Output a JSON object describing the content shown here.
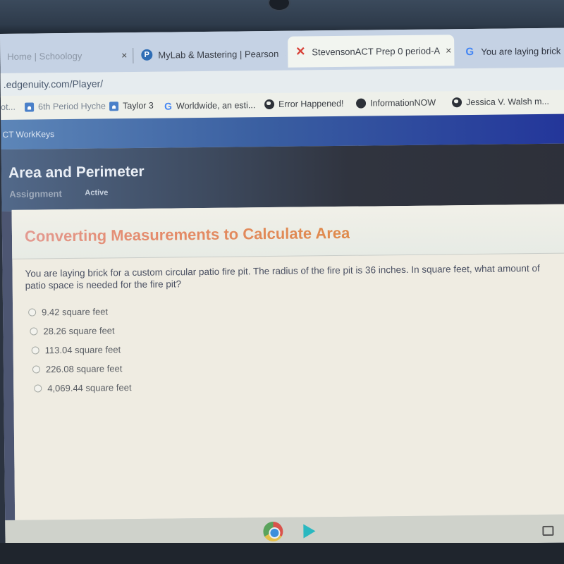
{
  "browser": {
    "tabs": [
      {
        "label": "Home | Schoology",
        "icon": "schoology-icon",
        "active": false,
        "faded": true
      },
      {
        "label": "MyLab & Mastering | Pearson",
        "icon": "pearson-icon",
        "active": false
      },
      {
        "label": "StevensonACT Prep 0 period-A",
        "icon": "edgenuity-x-icon",
        "active": true
      },
      {
        "label": "You are laying brick",
        "icon": "google-icon",
        "active": false
      }
    ],
    "close_glyph": "×",
    "url": ".edgenuity.com/Player/",
    "bookmarks": [
      {
        "label": "ot...",
        "icon": "",
        "faded": true
      },
      {
        "label": "6th Period Hyche",
        "icon": "classroom-icon",
        "faded": true
      },
      {
        "label": "Taylor 3",
        "icon": "classroom-icon"
      },
      {
        "label": "Worldwide, an esti...",
        "icon": "google-icon"
      },
      {
        "label": "Error Happened!",
        "icon": "globe-icon"
      },
      {
        "label": "InformationNOW",
        "icon": "info-now-icon"
      },
      {
        "label": "Jessica V. Walsh m...",
        "icon": "globe-icon"
      }
    ]
  },
  "app": {
    "course": "CT WorkKeys",
    "assignment_title": "Area and Perimeter",
    "assignment_type": "Assignment",
    "assignment_status": "Active"
  },
  "activity": {
    "title": "Converting Measurements to Calculate Area",
    "question": "You are laying brick for a custom circular patio fire pit. The radius of the fire pit is 36 inches. In square feet, what amount of patio space is needed for the fire pit?",
    "options": [
      {
        "label": "9.42 square feet",
        "selected": false
      },
      {
        "label": "28.26 square feet",
        "selected": false
      },
      {
        "label": "113.04 square feet",
        "selected": false
      },
      {
        "label": "226.08 square feet",
        "selected": false
      },
      {
        "label": "4,069.44 square feet",
        "selected": false
      }
    ]
  },
  "shelf": {
    "apps": [
      "chrome-icon",
      "play-store-icon"
    ],
    "tray": "overview-icon"
  },
  "colors": {
    "title_accent": "#df8a4a",
    "header_blue": "#22349a",
    "banner_dark": "#30343f"
  }
}
